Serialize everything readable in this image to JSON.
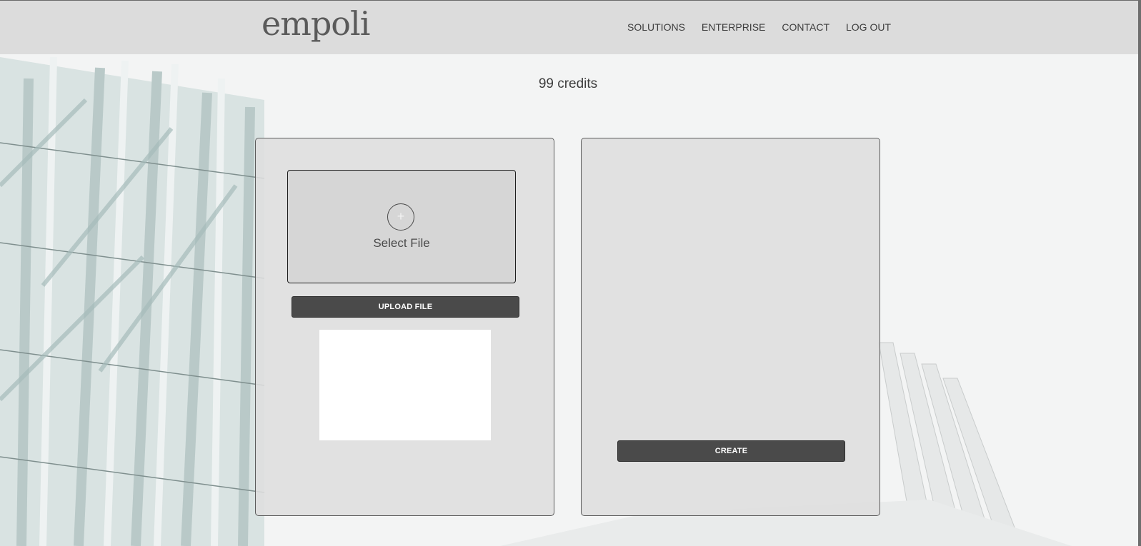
{
  "header": {
    "logo": "empoli",
    "nav": [
      "SOLUTIONS",
      "ENTERPRISE",
      "CONTACT",
      "LOG OUT"
    ]
  },
  "credits": "99 credits",
  "left_panel": {
    "plus_icon": "+",
    "select_file_label": "Select File",
    "upload_button": "UPLOAD FILE"
  },
  "right_panel": {
    "create_button": "CREATE"
  },
  "colors": {
    "header_bg": "#dcdcdc",
    "button_bg": "#4a4a4a",
    "panel_bg": "#dedede"
  }
}
